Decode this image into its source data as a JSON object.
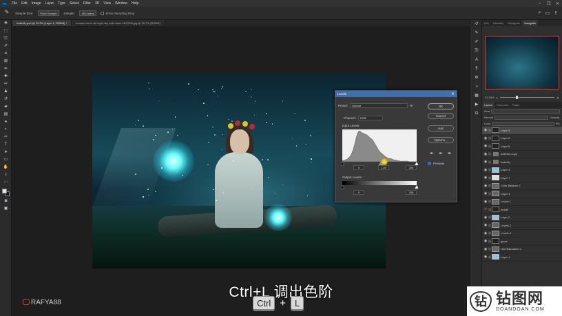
{
  "app": {
    "logo": "Ps"
  },
  "menu": [
    "File",
    "Edit",
    "Image",
    "Layer",
    "Type",
    "Select",
    "Filter",
    "3D",
    "View",
    "Window",
    "Help"
  ],
  "window_controls": [
    "–",
    "❐",
    "✕"
  ],
  "options": {
    "sample_size_label": "Sample Size:",
    "sample_size_value": "Point Sample",
    "sample_label": "Sample:",
    "sample_value": "All Layers",
    "show_ring_label": "Show Sampling Ring"
  },
  "tabs": [
    {
      "label": "butterfly.psd @ 33.3% (Layer 9, RGB/8) *"
    },
    {
      "label": "mosaic stone rail night sky wide stars 1847095.jpg @ 16.7% (RGB/8)"
    }
  ],
  "levels": {
    "title": "Levels",
    "close": "✕",
    "preset_label": "Preset:",
    "preset_value": "Default",
    "channel_label": "Channel:",
    "channel_value": "RGB",
    "input_label": "Input Levels:",
    "input_black": "0",
    "input_mid": "1.00",
    "input_white": "255",
    "output_label": "Output Levels:",
    "output_black": "0",
    "output_white": "255",
    "buttons": {
      "ok": "OK",
      "cancel": "Cancel",
      "auto": "Auto",
      "options": "Options..."
    },
    "preview_label": "Preview",
    "histogram": [
      2,
      2,
      3,
      4,
      6,
      8,
      12,
      18,
      26,
      36,
      44,
      48,
      47,
      45,
      44,
      43,
      42,
      40,
      38,
      36,
      34,
      30,
      26,
      22,
      18,
      15,
      13,
      11,
      9,
      7,
      6,
      5,
      5,
      4,
      3,
      3,
      2,
      2,
      1,
      1,
      1,
      1,
      1,
      1,
      0,
      0,
      0,
      0,
      0,
      0
    ]
  },
  "navigator": {
    "tabs": [
      "Info",
      "Libraries",
      "Histogram",
      "Navigator"
    ],
    "zoom": "33.33%",
    "zoom_level": 0.3
  },
  "layers": {
    "tabs": [
      "Layers",
      "Channels",
      "Paths"
    ],
    "kind_label": "Kind",
    "blend": "Normal",
    "opacity_label": "Opacity:",
    "lock_label": "Lock:",
    "fill_label": "Fill:",
    "items": [
      {
        "name": "Layer 9",
        "thumb": "dark",
        "sel": true
      },
      {
        "name": "Layer 8",
        "thumb": "dark"
      },
      {
        "name": "Layer 6",
        "thumb": "dark"
      },
      {
        "name": "butterfly copy",
        "thumb": "folder"
      },
      {
        "name": "butterfly",
        "thumb": "folder"
      },
      {
        "name": "Layer 3",
        "thumb": "sky"
      },
      {
        "name": "Layer 7",
        "thumb": "light"
      },
      {
        "name": "Color Balance 2",
        "thumb": "adj"
      },
      {
        "name": "Layer 4",
        "thumb": "adj"
      },
      {
        "name": "Levels 1",
        "thumb": "adj"
      },
      {
        "name": "model",
        "thumb": "dark",
        "red": true
      },
      {
        "name": "Layer 2",
        "thumb": "sky"
      },
      {
        "name": "Levels 2",
        "thumb": "adj"
      },
      {
        "name": "Levels 4",
        "thumb": "adj"
      },
      {
        "name": "grass",
        "thumb": "dark"
      },
      {
        "name": "Hue/Saturation 1",
        "thumb": "adj"
      },
      {
        "name": "Layer 1",
        "thumb": "sky"
      }
    ]
  },
  "caption": "Ctrl+L 调出色阶",
  "keys": {
    "ctrl": "Ctrl",
    "plus": "+",
    "l": "L"
  },
  "handle": "RAFYA88",
  "watermark": {
    "cn": "钻图网",
    "en": "DOANDOAN.COM"
  }
}
